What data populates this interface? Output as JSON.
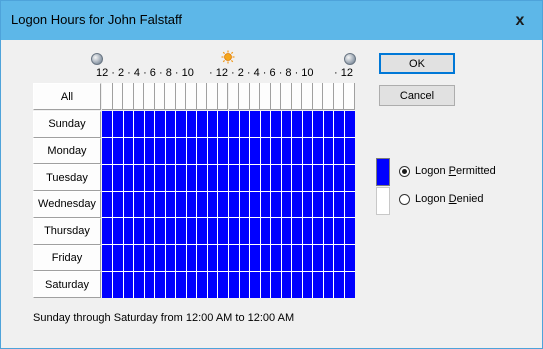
{
  "window": {
    "title": "Logon Hours for John Falstaff",
    "close_glyph": "x"
  },
  "hour_header": {
    "left_labels": "12 · 2 · 4 · 6 · 8 · 10",
    "middle_labels": "· 12 · 2 · 4 · 6 · 8 · 10",
    "end_label": "· 12",
    "icons": [
      "moon-icon",
      "sun-icon",
      "moon-icon"
    ]
  },
  "grid": {
    "all_label": "All",
    "days": [
      "Sunday",
      "Monday",
      "Tuesday",
      "Wednesday",
      "Thursday",
      "Friday",
      "Saturday"
    ],
    "hours_per_day": 24,
    "permitted_fraction": 1.0,
    "permitted_color": "#0000ff"
  },
  "buttons": {
    "ok": "OK",
    "cancel": "Cancel"
  },
  "legend": {
    "permitted_prefix": "Logon ",
    "permitted_underlined": "P",
    "permitted_rest": "ermitted",
    "denied_prefix": "Logon ",
    "denied_underlined": "D",
    "denied_rest": "enied",
    "selected": "permitted"
  },
  "status": {
    "text": "Sunday through Saturday from 12:00 AM to 12:00 AM"
  }
}
